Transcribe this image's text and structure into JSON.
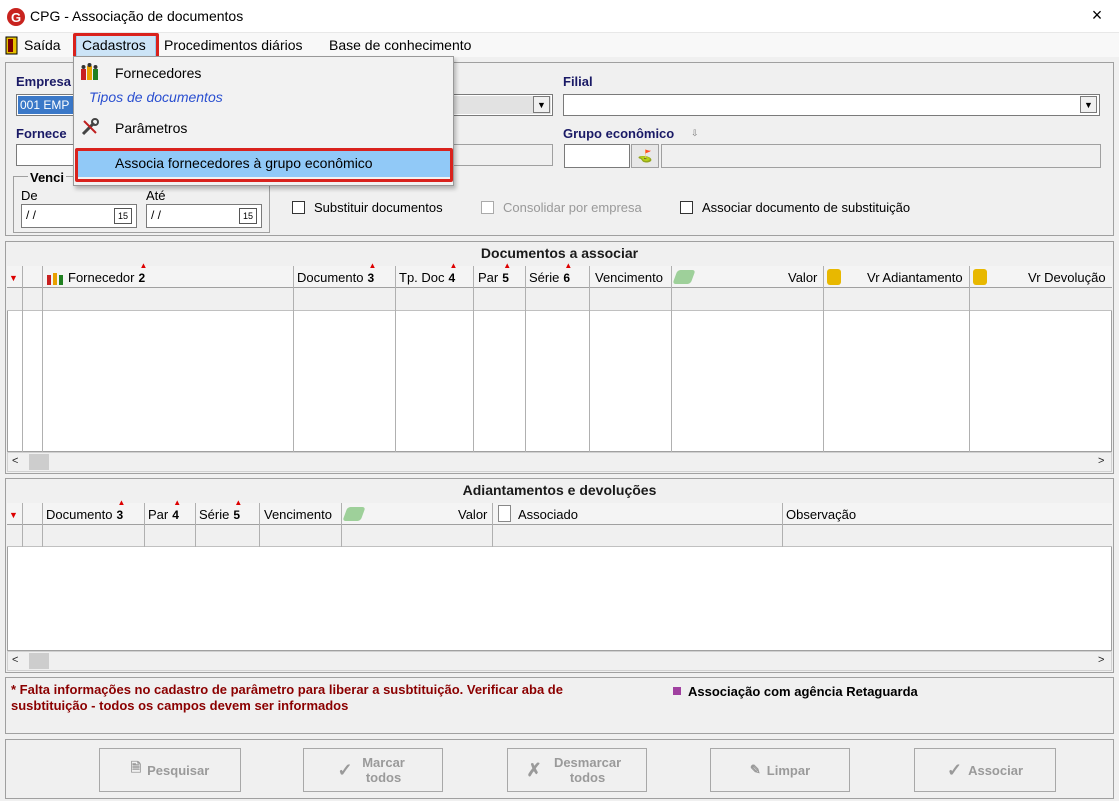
{
  "window": {
    "title": "CPG - Associação de documentos",
    "close_icon": "×"
  },
  "menubar": {
    "items": [
      "Saída",
      "Cadastros",
      "Procedimentos diários",
      "Base de conhecimento"
    ]
  },
  "dropdown": {
    "items": [
      {
        "label": "Fornecedores",
        "icon": "suppliers-icon"
      },
      {
        "label": "Tipos de documentos",
        "icon": ""
      },
      {
        "label": "Parâmetros",
        "icon": "tools-icon"
      },
      {
        "label": "Associa fornecedores à grupo econômico",
        "icon": ""
      }
    ]
  },
  "filters": {
    "empresa_label": "Empresa",
    "empresa_value": "001 EMP",
    "filial_label": "Filial",
    "filial_value": "",
    "fornecedor_label": "Fornece",
    "grupo_label": "Grupo econômico",
    "vencimento_label": "Venci",
    "de_label": "De",
    "ate_label": "Até",
    "de_value": " / /",
    "ate_value": " / /",
    "calendar_label": "15",
    "chk_substituir": "Substituir documentos",
    "chk_consolidar": "Consolidar por empresa",
    "chk_associar": "Associar documento de substituição"
  },
  "grid1": {
    "title": "Documentos a associar",
    "columns": [
      {
        "label": "Fornecedor",
        "sort": "2"
      },
      {
        "label": "Documento",
        "sort": "3"
      },
      {
        "label": "Tp. Doc",
        "sort": "4"
      },
      {
        "label": "Par",
        "sort": "5"
      },
      {
        "label": "Série",
        "sort": "6"
      },
      {
        "label": "Vencimento",
        "sort": ""
      },
      {
        "label": "Valor",
        "sort": ""
      },
      {
        "label": "Vr Adiantamento",
        "sort": ""
      },
      {
        "label": "Vr Devolução",
        "sort": ""
      }
    ]
  },
  "grid2": {
    "title": "Adiantamentos e devoluções",
    "columns": [
      {
        "label": "Documento",
        "sort": "3"
      },
      {
        "label": "Par",
        "sort": "4"
      },
      {
        "label": "Série",
        "sort": "5"
      },
      {
        "label": "Vencimento",
        "sort": ""
      },
      {
        "label": "Valor",
        "sort": ""
      },
      {
        "label": "Associado",
        "sort": ""
      },
      {
        "label": "Observação",
        "sort": ""
      }
    ]
  },
  "footer": {
    "warning": "* Falta informações no cadastro de parâmetro para liberar a susbtituição. Verificar aba de susbtituição - todos os campos devem ser informados",
    "legend": "Associação com agência Retaguarda",
    "legend_color": "#a040a0"
  },
  "buttons": {
    "pesquisar": "Pesquisar",
    "marcar": "Marcar todos",
    "desmarcar": "Desmarcar todos",
    "limpar": "Limpar",
    "associar": "Associar"
  },
  "colors": {
    "highlight_red": "#d9221d",
    "menu_selected": "#cce4f7",
    "label_navy": "#1a1a66",
    "warning_red": "#8b0000"
  }
}
